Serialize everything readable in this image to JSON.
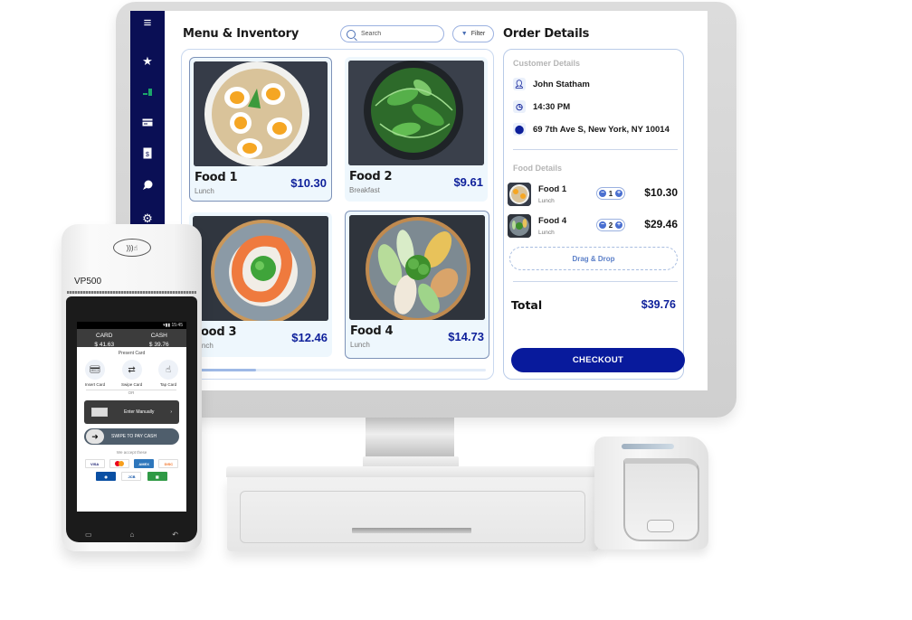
{
  "sidebar": {
    "items": [
      {
        "icon": "menu-icon",
        "glyph": "≡"
      },
      {
        "icon": "star-icon",
        "glyph": "★"
      },
      {
        "icon": "chart-icon",
        "glyph": "▂▆",
        "color": "#1ba66a"
      },
      {
        "icon": "credit-card-icon",
        "glyph": "▭"
      },
      {
        "icon": "invoice-icon",
        "glyph": "$"
      },
      {
        "icon": "chat-icon",
        "glyph": "●"
      },
      {
        "icon": "settings-icon",
        "glyph": "⚙"
      }
    ]
  },
  "menu": {
    "title": "Menu & Inventory",
    "search_placeholder": "Search",
    "filter_label": "Filter",
    "scroll_position": 0.22,
    "foods": [
      {
        "name": "Food 1",
        "category": "Lunch",
        "price": "$10.30",
        "selected": true
      },
      {
        "name": "Food 2",
        "category": "Breakfast",
        "price": "$9.61",
        "selected": false
      },
      {
        "name": "Food 3",
        "category": "Lunch",
        "price": "$12.46",
        "selected": false
      },
      {
        "name": "Food 4",
        "category": "Lunch",
        "price": "$14.73",
        "selected": true
      }
    ]
  },
  "order": {
    "title": "Order Details",
    "customer_label": "Customer Details",
    "customer": {
      "name": "John Statham",
      "time": "14:30 PM",
      "address": "69 7th Ave S, New York, NY 10014"
    },
    "food_label": "Food Details",
    "items": [
      {
        "name": "Food 1",
        "category": "Lunch",
        "qty": "1",
        "price": "$10.30"
      },
      {
        "name": "Food 4",
        "category": "Lunch",
        "qty": "2",
        "price": "$29.46"
      }
    ],
    "dropzone_label": "Drag & Drop",
    "total_label": "Total",
    "total_value": "$39.76",
    "checkout_label": "CHECKOUT"
  },
  "colors": {
    "sidebar": "#0a0f55",
    "accent": "#0d1f9a",
    "checkout": "#081a9c"
  },
  "terminal": {
    "brand": "VP500",
    "status_time": "15:45",
    "card_label": "CARD",
    "card_amount": "$ 41.63",
    "cash_label": "CASH",
    "cash_amount": "$ 39.76",
    "present_card": "Present Card",
    "methods": [
      "Insert Card",
      "Swipe Card",
      "Tap Card"
    ],
    "or_label": "OR",
    "enter_manually": "Enter Manually",
    "swipe_cash": "SWIPE TO PAY CASH",
    "accept_label": "We accept these",
    "card_brands": [
      "VISA",
      "Mastercard",
      "American Express",
      "Discover",
      "Diners",
      "JCB",
      "Gift Card"
    ]
  }
}
